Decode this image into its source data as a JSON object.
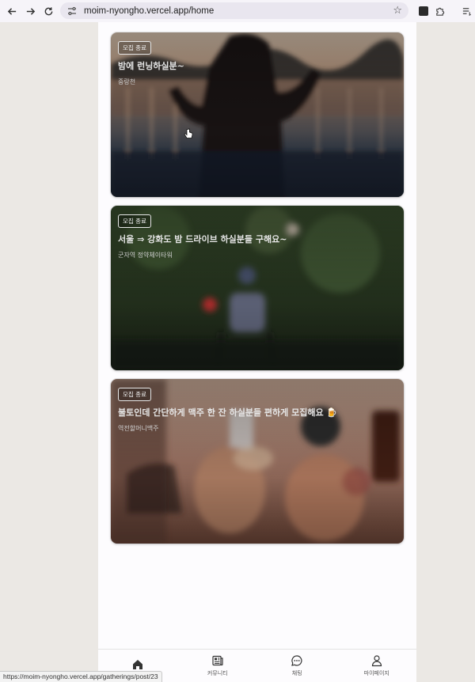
{
  "browser": {
    "url": "moim-nyongho.vercel.app/home"
  },
  "gatherings": [
    {
      "badge": "모집 종료",
      "title": "밤에 런닝하실분~",
      "place": "중랑천"
    },
    {
      "badge": "모집 종료",
      "title": "서울 ⇒ 강화도 밤 드라이브 하실분들 구해요~",
      "place": "군자역 정약체이타워"
    },
    {
      "badge": "모집 종료",
      "title": "불토인데 간단하게 맥주 한 잔 하실분들 편하게 모집해요 🍺",
      "place": "역전할머니맥주"
    }
  ],
  "bottom_nav": [
    {
      "label": "",
      "icon": "home-icon"
    },
    {
      "label": "커뮤니티",
      "icon": "newspaper-icon"
    },
    {
      "label": "채팅",
      "icon": "chat-icon"
    },
    {
      "label": "마이페이지",
      "icon": "user-icon"
    }
  ],
  "status_url": "https://moim-nyongho.vercel.app/gatherings/post/23"
}
